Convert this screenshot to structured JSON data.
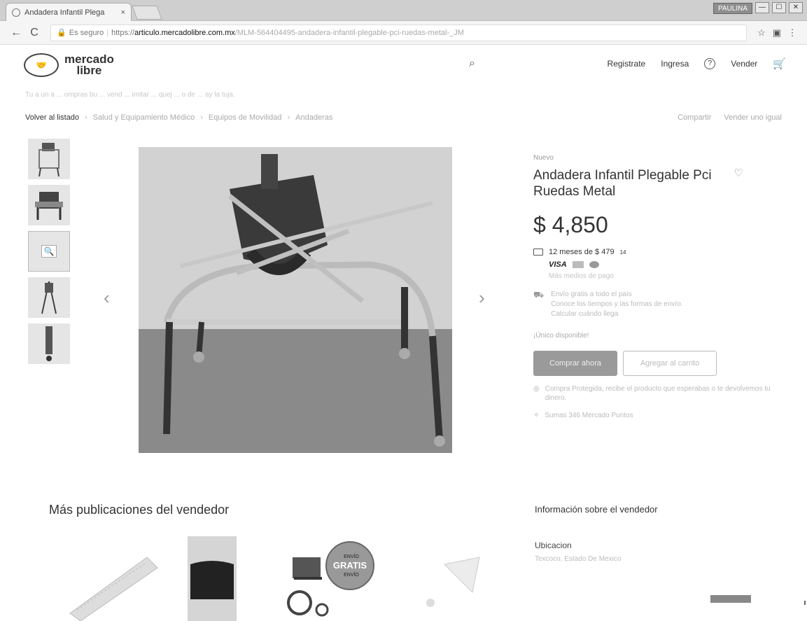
{
  "browser": {
    "tab_title": "Andadera Infantil Plega",
    "tab_close": "×",
    "user_chip": "PAULINA",
    "win_buttons": [
      "—",
      "☐",
      "✕"
    ],
    "secure_label": "Es seguro",
    "url_scheme": "https://",
    "url_host": "articulo.mercadolibre.com.mx",
    "url_rest": "/MLM-564404495-andadera-infantil-plegable-pci-ruedas-metal-_JM",
    "back_icon": "←",
    "reload_icon": "C",
    "star_icon": "☆",
    "ext_icon": "▣",
    "menu_icon": "⋮"
  },
  "header": {
    "logo_line1": "mercado",
    "logo_line2": "libre",
    "logo_symbol": "🤝",
    "search_icon": "⌕",
    "links": [
      "Registrate",
      "Ingresa"
    ],
    "help_symbol": "?",
    "sell": "Vender",
    "cart_icon": "🛒"
  },
  "faint_line": "Tu a un a ... ompras bu ... vend ... imitar ... quej ... o de ... ay la tuja.",
  "breadcrumb": {
    "back": "Volver al listado",
    "items": [
      "Salud y Equipamiento Médico",
      "Equipos de Movilidad",
      "Andaderas"
    ],
    "sep": "›",
    "share": "Compartir",
    "sell_one": "Vender uno igual"
  },
  "gallery": {
    "thumb_count": 5,
    "zoom_icon": "🔍",
    "prev": "‹",
    "next": "›"
  },
  "product": {
    "condition": "Nuevo",
    "title": "Andadera Infantil Plegable Pci Ruedas Metal",
    "favorite_icon": "♡",
    "price": "$ 4,850",
    "installments": "12 meses de $ 479",
    "installments_sup": "14",
    "visa": "VISA",
    "more_payments": "Más medios de pago",
    "shipping_icon": "⛟",
    "shipping_lines": [
      "Envío gratis a todo el país",
      "Conoce los tiempos y las formas de envío.",
      "Calcular cuándo llega"
    ],
    "stock": "¡Único disponible!",
    "buy_button": "Comprar ahora",
    "cart_button": "Agregar al carrito",
    "protected_icon": "◎",
    "protected": "Compra Protegida, recibe el producto que esperabas o te devolvemos tu dinero.",
    "points_icon": "✧",
    "points": "Sumas 346 Mercado Puntos"
  },
  "bottom": {
    "more_pubs": "Más publicaciones del vendedor",
    "seller_info": "Información sobre el vendedor",
    "location_label": "Ubicacion",
    "location_value": "Texcoco, Estado De Mexico",
    "badge_top": "ENVÍO",
    "badge_mid": "GRATIS",
    "badge_bottom": "ENVÍO"
  }
}
